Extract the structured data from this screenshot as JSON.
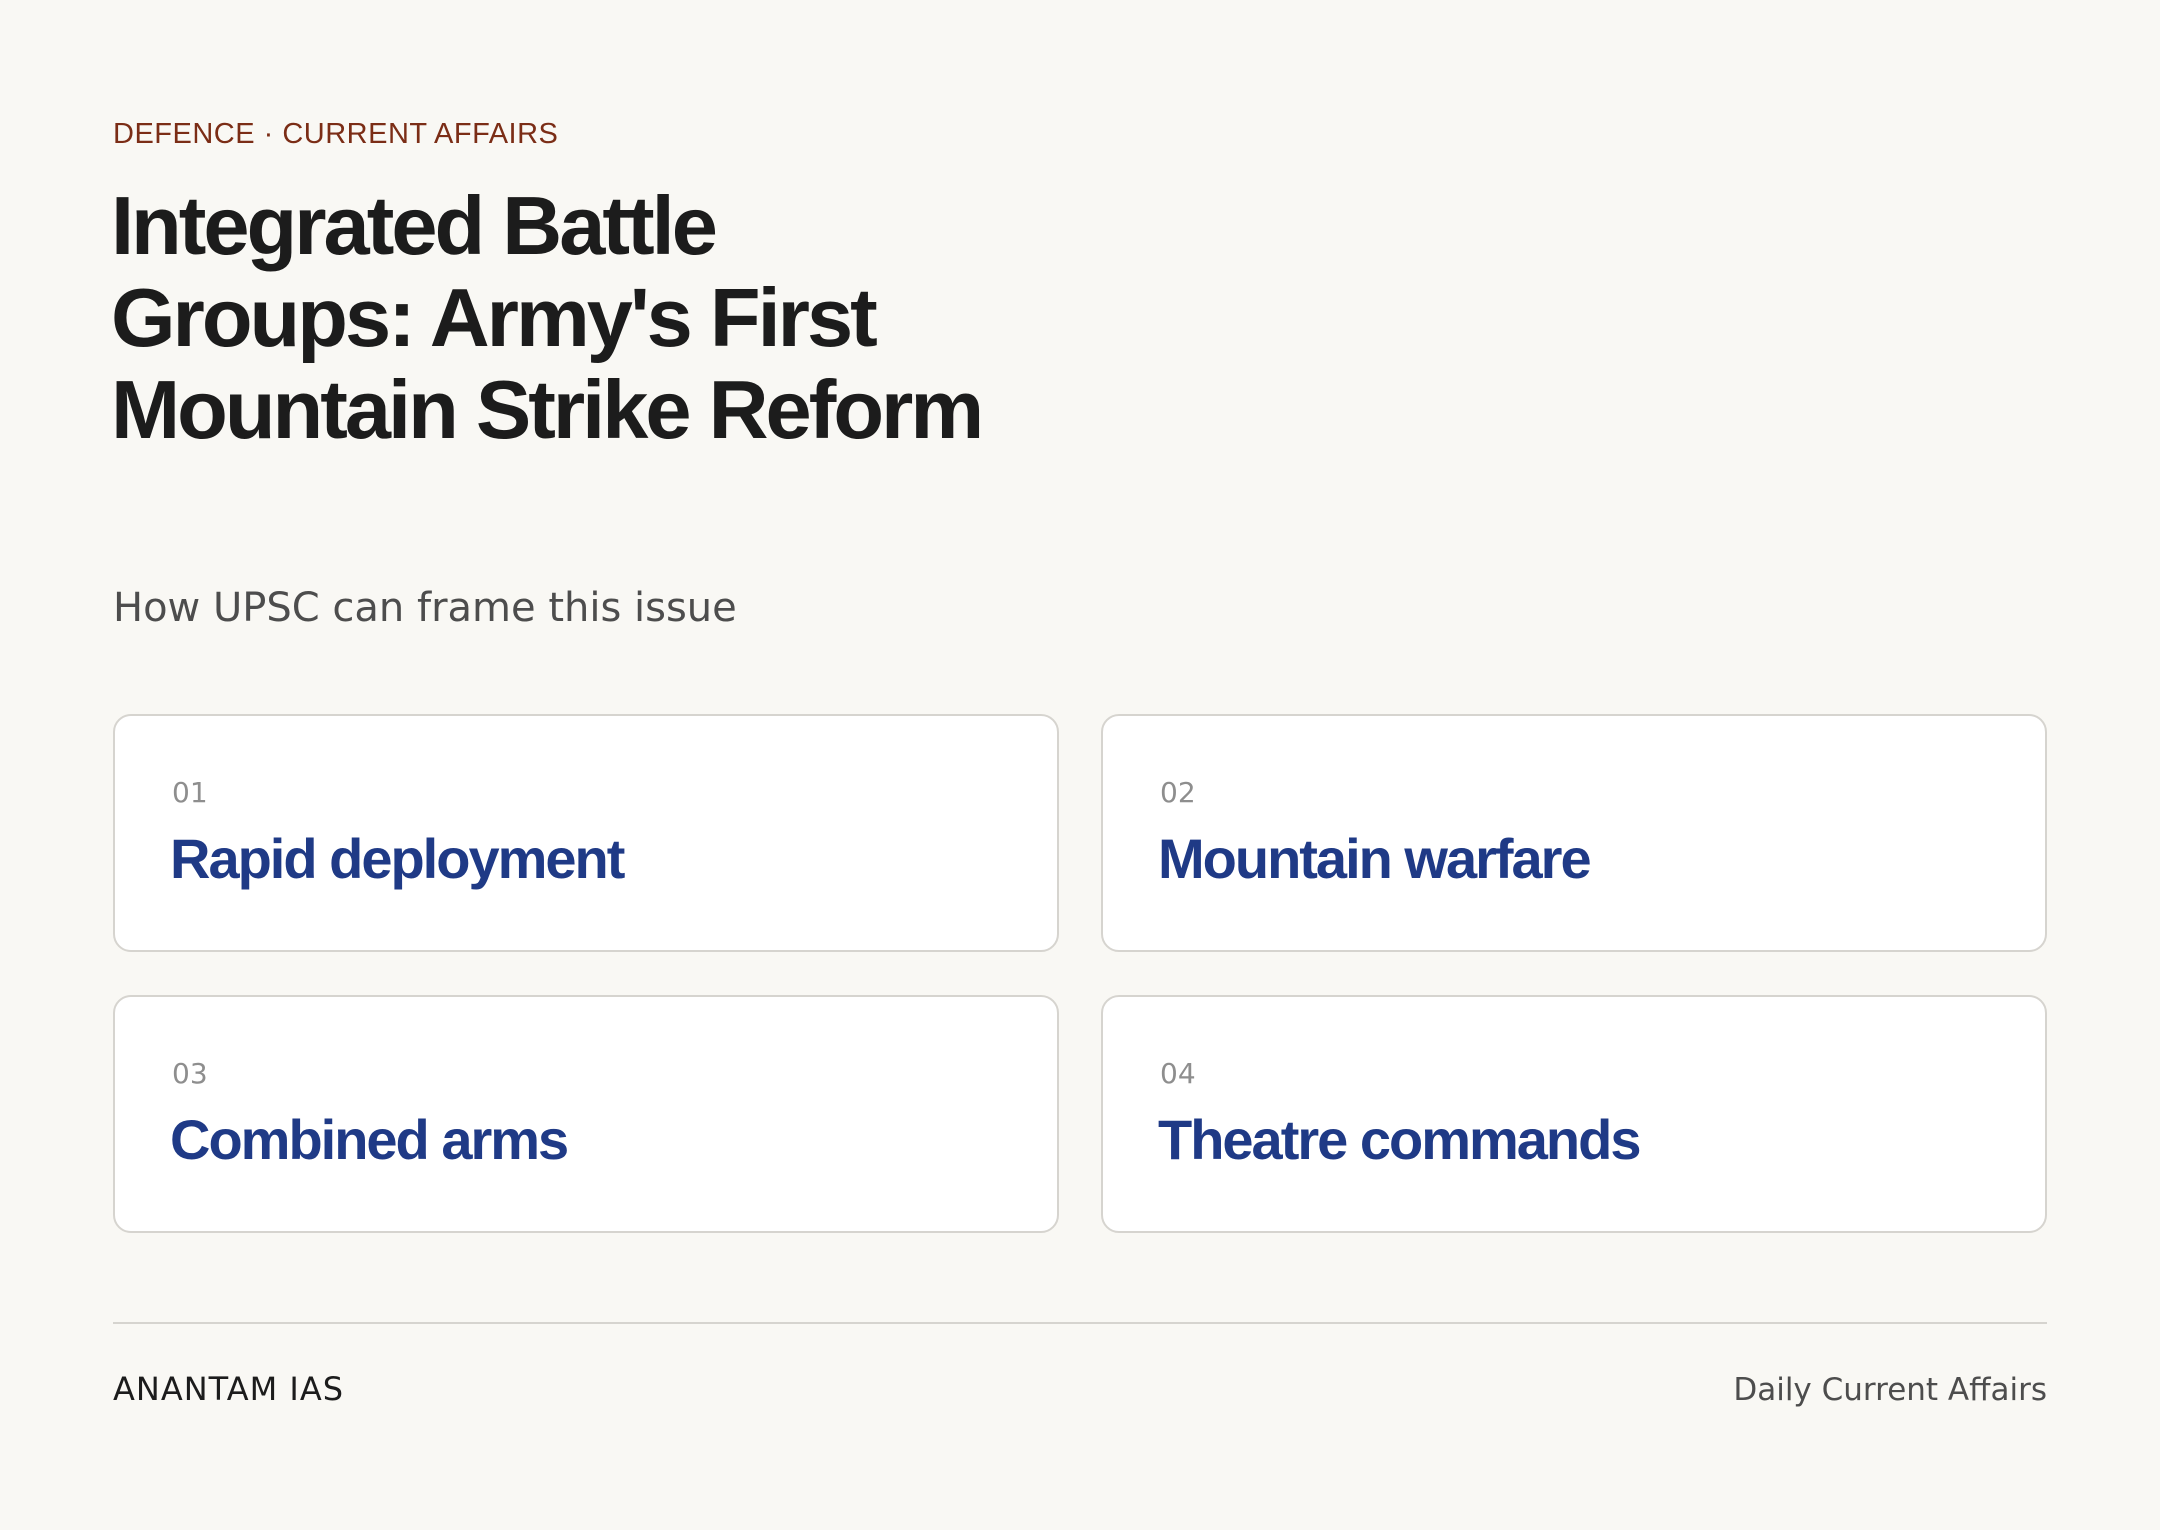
{
  "header": {
    "kicker": "DEFENCE · CURRENT AFFAIRS",
    "title": "Integrated Battle Groups: Army's First Mountain Strike Reform",
    "subtitle": "How UPSC can frame this issue"
  },
  "cards": [
    {
      "number": "01",
      "label": "Rapid deployment"
    },
    {
      "number": "02",
      "label": "Mountain warfare"
    },
    {
      "number": "03",
      "label": "Combined arms"
    },
    {
      "number": "04",
      "label": "Theatre commands"
    }
  ],
  "footer": {
    "brand": "ANANTAM IAS",
    "tagline": "Daily Current Affairs"
  },
  "colors": {
    "background": "#f9f8f4",
    "kicker": "#7b2d16",
    "title": "#1c1c1c",
    "card_label": "#1f3a86",
    "card_border": "#d6d4cf"
  }
}
